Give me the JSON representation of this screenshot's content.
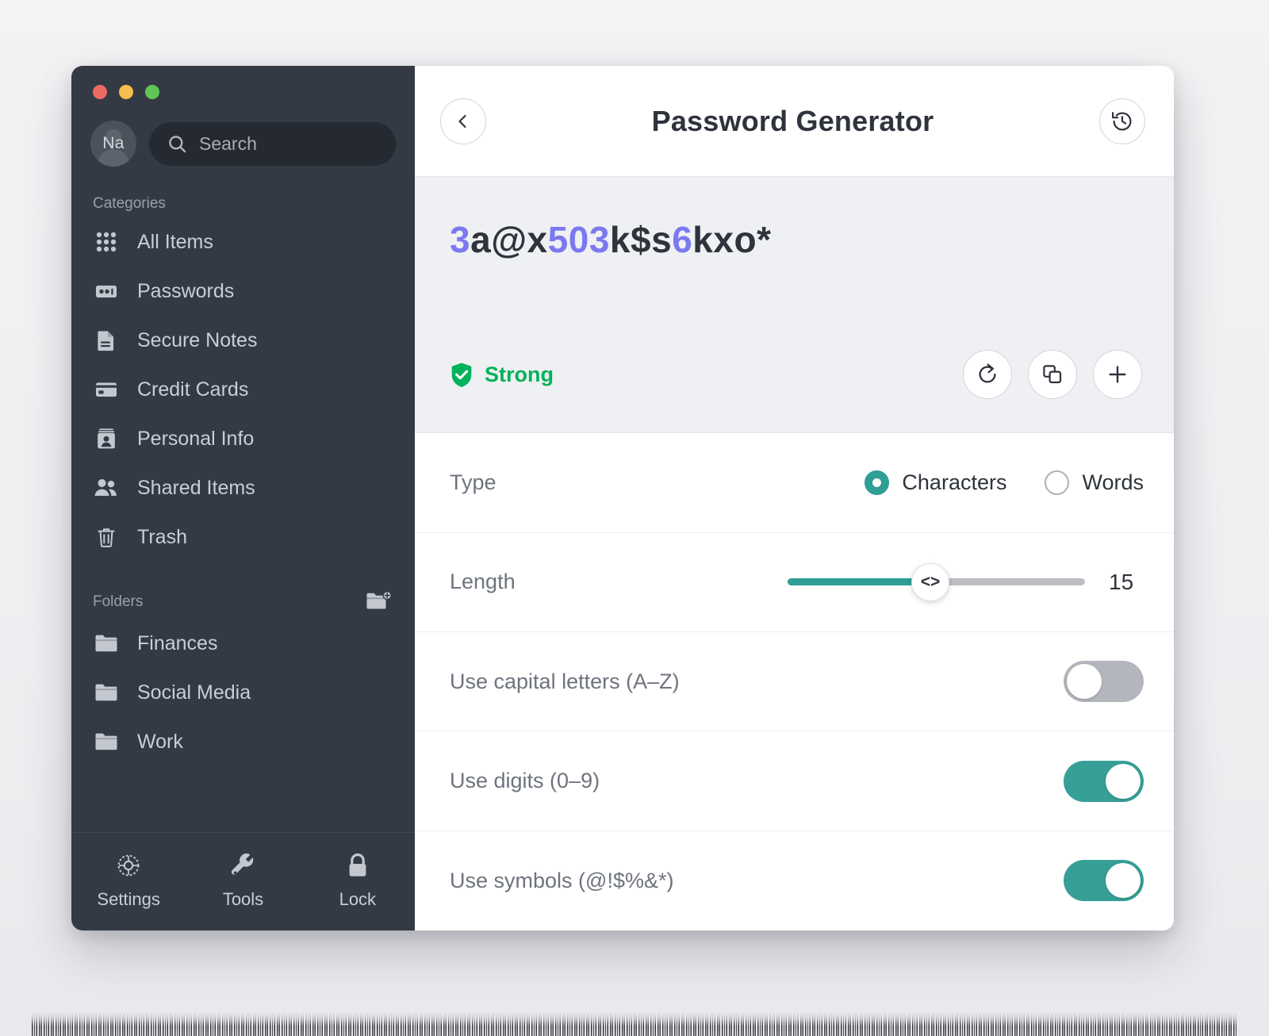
{
  "window": {
    "traffic_lights": [
      "close",
      "minimize",
      "zoom"
    ]
  },
  "sidebar": {
    "account": {
      "initials": "Na"
    },
    "search": {
      "placeholder": "Search",
      "value": "",
      "icon": "search-icon"
    },
    "categories_label": "Categories",
    "categories": [
      {
        "label": "All Items",
        "icon": "grid-icon"
      },
      {
        "label": "Passwords",
        "icon": "password-field-icon"
      },
      {
        "label": "Secure Notes",
        "icon": "document-icon"
      },
      {
        "label": "Credit Cards",
        "icon": "credit-card-icon"
      },
      {
        "label": "Personal Info",
        "icon": "id-card-icon"
      },
      {
        "label": "Shared Items",
        "icon": "people-icon"
      },
      {
        "label": "Trash",
        "icon": "trash-icon"
      }
    ],
    "folders_label": "Folders",
    "add_folder_icon": "folder-plus-icon",
    "folders": [
      {
        "label": "Finances",
        "icon": "folder-icon"
      },
      {
        "label": "Social Media",
        "icon": "folder-icon"
      },
      {
        "label": "Work",
        "icon": "folder-icon"
      }
    ],
    "footer": [
      {
        "label": "Settings",
        "icon": "gear-icon"
      },
      {
        "label": "Tools",
        "icon": "wrench-icon"
      },
      {
        "label": "Lock",
        "icon": "lock-icon"
      }
    ]
  },
  "main": {
    "header": {
      "back_icon": "chevron-left-icon",
      "title": "Password Generator",
      "history_icon": "history-icon"
    },
    "password": {
      "value": "3a@x503k$s6kxo*",
      "digit_color": "#7c78ef",
      "text_color": "#2e333c",
      "strength_label": "Strong",
      "strength_color": "#00b259",
      "strength_icon": "shield-check-icon",
      "actions": [
        {
          "name": "regenerate-button",
          "icon": "refresh-icon"
        },
        {
          "name": "copy-button",
          "icon": "copy-icon"
        },
        {
          "name": "add-button",
          "icon": "plus-icon"
        }
      ]
    },
    "options": {
      "type": {
        "label": "Type",
        "choices": [
          {
            "label": "Characters",
            "selected": true
          },
          {
            "label": "Words",
            "selected": false
          }
        ]
      },
      "length": {
        "label": "Length",
        "value": "15",
        "fill_percent": 48,
        "thumb_glyph": "<>",
        "fill_color": "#2f9e94",
        "track_color": "#bcbec3"
      },
      "toggles": [
        {
          "label": "Use capital letters (A–Z)",
          "on": false
        },
        {
          "label": "Use digits (0–9)",
          "on": true
        },
        {
          "label": "Use symbols (@!$%&*)",
          "on": true
        }
      ]
    }
  },
  "theme": {
    "sidebar_bg": "#343a44",
    "accent_teal": "#2f9e94",
    "accent_purple": "#7c78ef",
    "panel_bg": "#eff0f3"
  }
}
